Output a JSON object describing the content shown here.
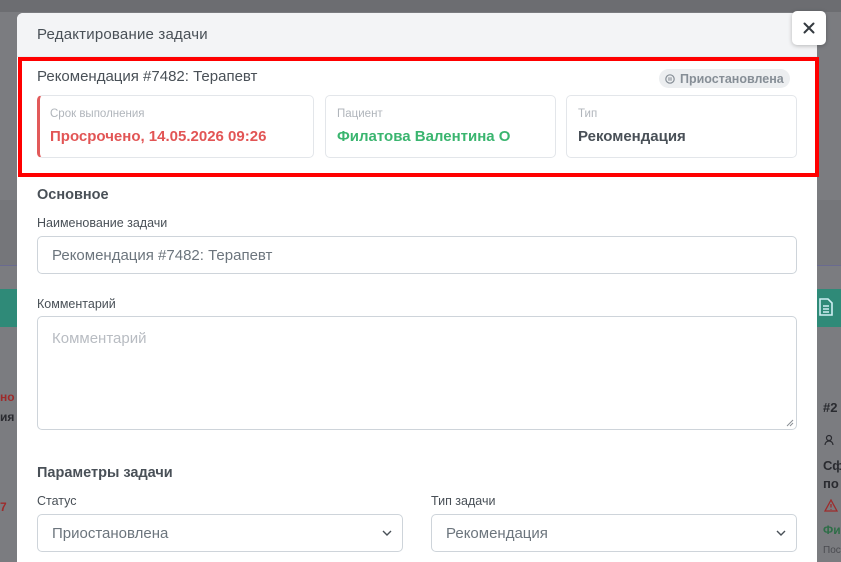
{
  "modal": {
    "title": "Редактирование задачи",
    "close_glyph": "×"
  },
  "summary": {
    "task_name": "Рекомендация #7482: Терапевт",
    "status_badge": "Приостановлена",
    "cards": [
      {
        "label": "Срок выполнения",
        "value": "Просрочено, 14.05.2026 09:26"
      },
      {
        "label": "Пациент",
        "value": "Филатова Валентина О"
      },
      {
        "label": "Тип",
        "value": "Рекомендация"
      }
    ]
  },
  "main": {
    "section_title": "Основное",
    "name_label": "Наименование задачи",
    "name_value": "Рекомендация #7482: Терапевт",
    "comment_label": "Комментарий",
    "comment_placeholder": "Комментарий"
  },
  "params": {
    "section_title": "Параметры задачи",
    "status_label": "Статус",
    "status_value": "Приостановлена",
    "type_label": "Тип задачи",
    "type_value": "Рекомендация"
  },
  "background": {
    "left_fragments": [
      "но",
      "ия",
      "7"
    ],
    "right_fragments": [
      "#2",
      "Сф",
      "по",
      "Фи",
      "Пос"
    ]
  },
  "colors": {
    "overdue": "#e25555",
    "patient": "#3ab56f",
    "highlight": "#ff0000"
  }
}
